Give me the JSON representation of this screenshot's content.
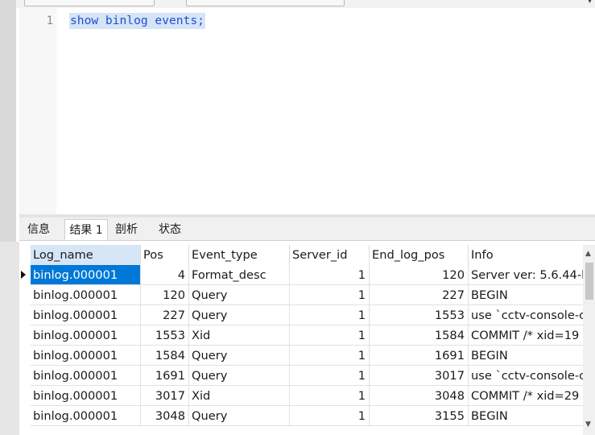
{
  "editor": {
    "line_number": "1",
    "code": "show binlog events;"
  },
  "tabs": [
    {
      "label": "信息",
      "active": false
    },
    {
      "label": "结果 1",
      "active": true
    },
    {
      "label": "剖析",
      "active": false
    },
    {
      "label": "状态",
      "active": false
    }
  ],
  "table": {
    "columns": [
      "Log_name",
      "Pos",
      "Event_type",
      "Server_id",
      "End_log_pos",
      "Info"
    ],
    "rows": [
      [
        "binlog.000001",
        "4",
        "Format_desc",
        "1",
        "120",
        "Server ver: 5.6.44-l"
      ],
      [
        "binlog.000001",
        "120",
        "Query",
        "1",
        "227",
        "BEGIN"
      ],
      [
        "binlog.000001",
        "227",
        "Query",
        "1",
        "1553",
        "use `cctv-console-c"
      ],
      [
        "binlog.000001",
        "1553",
        "Xid",
        "1",
        "1584",
        "COMMIT /* xid=19"
      ],
      [
        "binlog.000001",
        "1584",
        "Query",
        "1",
        "1691",
        "BEGIN"
      ],
      [
        "binlog.000001",
        "1691",
        "Query",
        "1",
        "3017",
        "use `cctv-console-c"
      ],
      [
        "binlog.000001",
        "3017",
        "Xid",
        "1",
        "3048",
        "COMMIT /* xid=29"
      ],
      [
        "binlog.000001",
        "3048",
        "Query",
        "1",
        "3155",
        "BEGIN"
      ]
    ]
  },
  "scrollbar": {
    "up_icon": "▲",
    "down_icon": "▼",
    "dropdown_icon": "▾"
  }
}
